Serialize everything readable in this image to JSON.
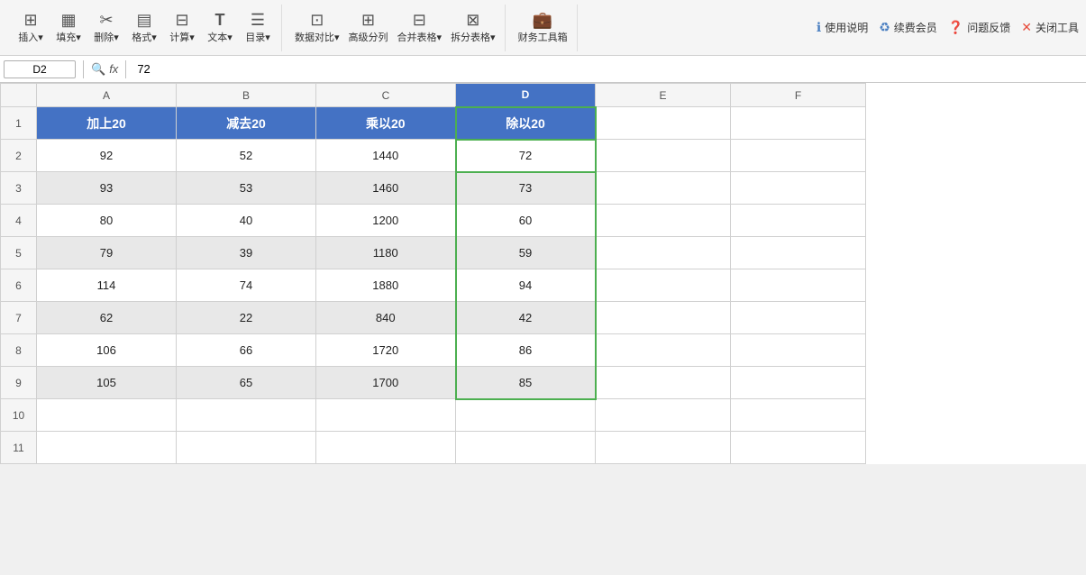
{
  "toolbar": {
    "groups": [
      {
        "buttons": [
          {
            "icon": "⊞",
            "label": "插入▾",
            "name": "insert-btn"
          },
          {
            "icon": "▦",
            "label": "填充▾",
            "name": "fill-btn"
          },
          {
            "icon": "✂",
            "label": "删除▾",
            "name": "delete-btn"
          },
          {
            "icon": "▤",
            "label": "格式▾",
            "name": "format-btn"
          },
          {
            "icon": "⊟",
            "label": "计算▾",
            "name": "calc-btn"
          },
          {
            "icon": "T",
            "label": "文本▾",
            "name": "text-btn"
          },
          {
            "icon": "☰",
            "label": "目录▾",
            "name": "toc-btn"
          }
        ]
      },
      {
        "buttons": [
          {
            "icon": "⊡",
            "label": "数据对比▾",
            "name": "compare-btn"
          },
          {
            "icon": "⊞",
            "label": "高级分列",
            "name": "split-btn"
          },
          {
            "icon": "⊟",
            "label": "合并表格▾",
            "name": "merge-btn"
          },
          {
            "icon": "⊠",
            "label": "拆分表格▾",
            "name": "unsplit-btn"
          }
        ]
      },
      {
        "buttons": [
          {
            "icon": "💼",
            "label": "财务工具箱",
            "name": "finance-btn"
          }
        ]
      }
    ],
    "right": [
      {
        "icon": "?",
        "label": "使用说明",
        "name": "help-btn"
      },
      {
        "icon": "♻",
        "label": "续费会员",
        "name": "renew-btn"
      },
      {
        "icon": "?",
        "label": "问题反馈",
        "name": "feedback-btn"
      },
      {
        "icon": "✕",
        "label": "关闭工具",
        "name": "close-btn"
      }
    ]
  },
  "formula_bar": {
    "cell_ref": "D2",
    "formula_label": "fx",
    "formula_value": "72"
  },
  "columns": {
    "labels": [
      "",
      "A",
      "B",
      "C",
      "D",
      "E",
      "F"
    ],
    "widths": [
      40,
      150,
      150,
      150,
      150,
      150,
      150
    ]
  },
  "headers": {
    "row": [
      "加上20",
      "减去20",
      "乘以20",
      "除以20"
    ]
  },
  "rows": [
    {
      "num": 2,
      "a": "92",
      "b": "52",
      "c": "1440",
      "d": "72",
      "striped": false
    },
    {
      "num": 3,
      "a": "93",
      "b": "53",
      "c": "1460",
      "d": "73",
      "striped": true
    },
    {
      "num": 4,
      "a": "80",
      "b": "40",
      "c": "1200",
      "d": "60",
      "striped": false
    },
    {
      "num": 5,
      "a": "79",
      "b": "39",
      "c": "1180",
      "d": "59",
      "striped": true
    },
    {
      "num": 6,
      "a": "114",
      "b": "74",
      "c": "1880",
      "d": "94",
      "striped": false
    },
    {
      "num": 7,
      "a": "62",
      "b": "22",
      "c": "840",
      "d": "42",
      "striped": true
    },
    {
      "num": 8,
      "a": "106",
      "b": "66",
      "c": "1720",
      "d": "86",
      "striped": false
    },
    {
      "num": 9,
      "a": "105",
      "b": "65",
      "c": "1700",
      "d": "85",
      "striped": true
    }
  ],
  "empty_rows": [
    10,
    11
  ]
}
